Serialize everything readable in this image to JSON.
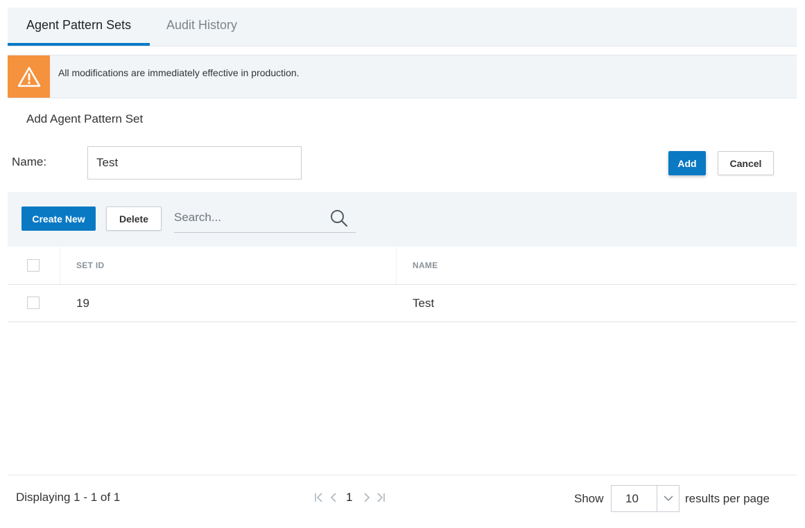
{
  "tabs": [
    {
      "label": "Agent Pattern Sets",
      "active": true
    },
    {
      "label": "Audit History",
      "active": false
    }
  ],
  "banner": {
    "icon": "warning-icon",
    "text": "All modifications are immediately effective in production.",
    "color": "#f5923e"
  },
  "form": {
    "title": "Add Agent Pattern Set",
    "name_label": "Name:",
    "name_value": "Test",
    "add_label": "Add",
    "cancel_label": "Cancel"
  },
  "toolbar": {
    "create_label": "Create New",
    "delete_label": "Delete",
    "search_placeholder": "Search...",
    "search_icon": "search-icon"
  },
  "table": {
    "columns": [
      "SET ID",
      "NAME"
    ],
    "rows": [
      {
        "set_id": "19",
        "name": "Test"
      }
    ]
  },
  "footer": {
    "displaying": "Displaying 1 - 1 of 1",
    "current_page": "1",
    "show_label": "Show",
    "per_page": "10",
    "per_page_label": "results per page"
  },
  "colors": {
    "accent": "#0a79c4",
    "warning": "#f5923e",
    "panel_bg": "#f1f5f8"
  }
}
